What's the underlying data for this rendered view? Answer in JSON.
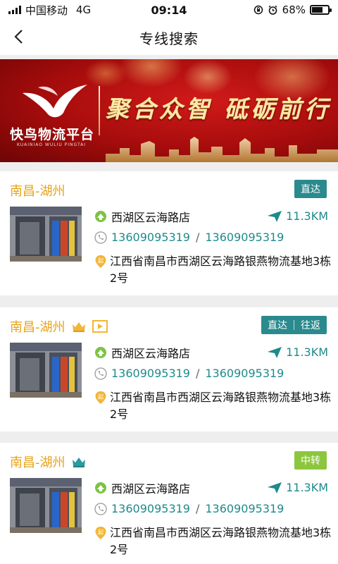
{
  "status": {
    "carrier": "中国移动",
    "network": "4G",
    "time": "09:14",
    "battery": "68%",
    "battery_level": 0.68
  },
  "nav": {
    "title": "专线搜索"
  },
  "banner": {
    "brand": "快鸟物流平台",
    "brand_sub": "KUAINIAO WULIU PINGTAI",
    "slogan": "聚合众智 砥砺前行"
  },
  "cards": [
    {
      "route": "南昌-湖州",
      "badges": [
        "直达"
      ],
      "badge_color": "#2a8a8e",
      "name": "西湖区云海路店",
      "distance": "11.3KM",
      "phone1": "13609095319",
      "phone_sep": "/",
      "phone2": "13609095319",
      "address": "江西省南昌市西湖区云海路银燕物流基地3栋2号"
    },
    {
      "route": "南昌-湖州",
      "badges": [
        "直达",
        "往返"
      ],
      "badge_color": "#2a8a8e",
      "name": "西湖区云海路店",
      "distance": "11.3KM",
      "phone1": "13609095319",
      "phone_sep": "/",
      "phone2": "13609095319",
      "address": "江西省南昌市西湖区云海路银燕物流基地3栋2号"
    },
    {
      "route": "南昌-湖州",
      "badges": [
        "中转"
      ],
      "badge_color": "#8cc63e",
      "name": "西湖区云海路店",
      "distance": "11.3KM",
      "phone1": "13609095319",
      "phone_sep": "/",
      "phone2": "13609095319",
      "address": "江西省南昌市西湖区云海路银燕物流基地3栋2号"
    }
  ]
}
